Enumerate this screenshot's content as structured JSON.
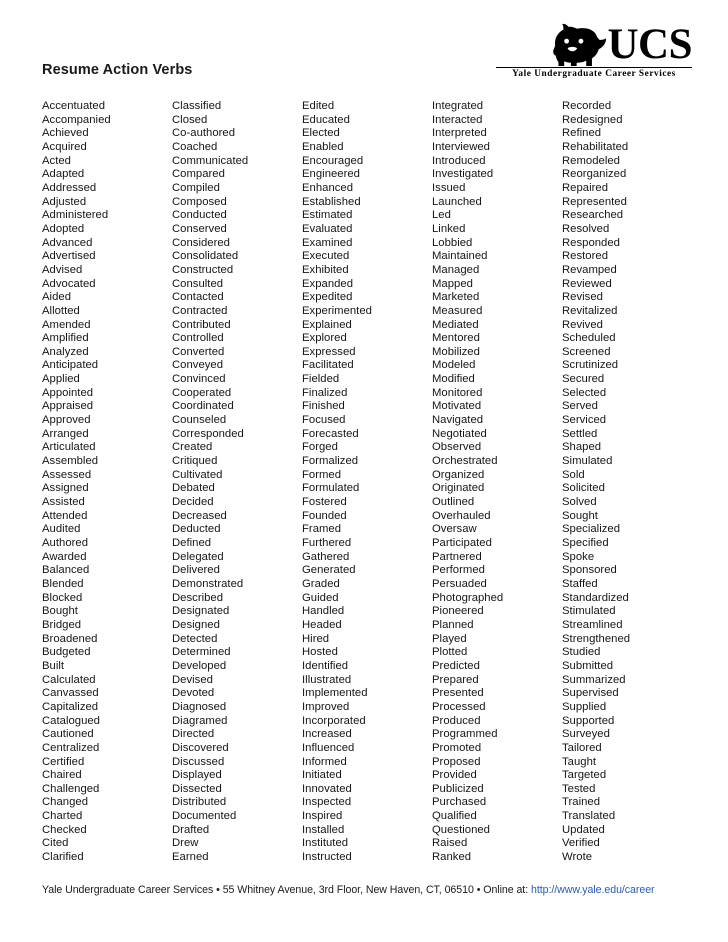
{
  "document": {
    "title": "Resume Action Verbs"
  },
  "logo": {
    "mark": "bulldog-icon",
    "acronym": "UCS",
    "subtitle": "Yale Undergraduate Career Services"
  },
  "columns": [
    {
      "id": "column-1",
      "words": [
        "Accentuated",
        "Accompanied",
        "Achieved",
        "Acquired",
        "Acted",
        "Adapted",
        "Addressed",
        "Adjusted",
        "Administered",
        "Adopted",
        "Advanced",
        "Advertised",
        "Advised",
        "Advocated",
        "Aided",
        "Allotted",
        "Amended",
        "Amplified",
        "Analyzed",
        "Anticipated",
        "Applied",
        "Appointed",
        "Appraised",
        "Approved",
        "Arranged",
        "Articulated",
        "Assembled",
        "Assessed",
        "Assigned",
        "Assisted",
        "Attended",
        "Audited",
        "Authored",
        "Awarded",
        "Balanced",
        "Blended",
        "Blocked",
        "Bought",
        "Bridged",
        "Broadened",
        "Budgeted",
        "Built",
        "Calculated",
        "Canvassed",
        "Capitalized",
        "Catalogued",
        "Cautioned",
        "Centralized",
        "Certified",
        "Chaired",
        "Challenged",
        "Changed",
        "Charted",
        "Checked",
        "Cited",
        "Clarified"
      ]
    },
    {
      "id": "column-2",
      "words": [
        "Classified",
        "Closed",
        "Co-authored",
        "Coached",
        "Communicated",
        "Compared",
        "Compiled",
        "Composed",
        "Conducted",
        "Conserved",
        "Considered",
        "Consolidated",
        "Constructed",
        "Consulted",
        "Contacted",
        "Contracted",
        "Contributed",
        "Controlled",
        "Converted",
        "Conveyed",
        "Convinced",
        "Cooperated",
        "Coordinated",
        "Counseled",
        "Corresponded",
        "Created",
        "Critiqued",
        "Cultivated",
        "Debated",
        "Decided",
        "Decreased",
        "Deducted",
        "Defined",
        "Delegated",
        "Delivered",
        "Demonstrated",
        "Described",
        "Designated",
        "Designed",
        "Detected",
        "Determined",
        "Developed",
        "Devised",
        "Devoted",
        "Diagnosed",
        "Diagramed",
        "Directed",
        "Discovered",
        "Discussed",
        "Displayed",
        "Dissected",
        "Distributed",
        "Documented",
        "Drafted",
        "Drew",
        "Earned"
      ]
    },
    {
      "id": "column-3",
      "words": [
        "Edited",
        "Educated",
        "Elected",
        "Enabled",
        "Encouraged",
        "Engineered",
        "Enhanced",
        "Established",
        "Estimated",
        "Evaluated",
        "Examined",
        "Executed",
        "Exhibited",
        "Expanded",
        "Expedited",
        "Experimented",
        "Explained",
        "Explored",
        "Expressed",
        "Facilitated",
        "Fielded",
        "Finalized",
        "Finished",
        "Focused",
        "Forecasted",
        "Forged",
        "Formalized",
        "Formed",
        "Formulated",
        "Fostered",
        "Founded",
        "Framed",
        "Furthered",
        "Gathered",
        "Generated",
        "Graded",
        "Guided",
        "Handled",
        "Headed",
        "Hired",
        "Hosted",
        "Identified",
        "Illustrated",
        "Implemented",
        "Improved",
        "Incorporated",
        "Increased",
        "Influenced",
        "Informed",
        "Initiated",
        "Innovated",
        "Inspected",
        "Inspired",
        "Installed",
        "Instituted",
        "Instructed"
      ]
    },
    {
      "id": "column-4",
      "words": [
        "Integrated",
        "Interacted",
        "Interpreted",
        "Interviewed",
        "Introduced",
        "Investigated",
        "Issued",
        "Launched",
        "Led",
        "Linked",
        "Lobbied",
        "Maintained",
        "Managed",
        "Mapped",
        "Marketed",
        "Measured",
        "Mediated",
        "Mentored",
        "Mobilized",
        "Modeled",
        "Modified",
        "Monitored",
        "Motivated",
        "Navigated",
        "Negotiated",
        "Observed",
        "Orchestrated",
        "Organized",
        "Originated",
        "Outlined",
        "Overhauled",
        "Oversaw",
        "Participated",
        "Partnered",
        "Performed",
        "Persuaded",
        "Photographed",
        "Pioneered",
        "Planned",
        "Played",
        "Plotted",
        "Predicted",
        "Prepared",
        "Presented",
        "Processed",
        "Produced",
        "Programmed",
        "Promoted",
        "Proposed",
        "Provided",
        "Publicized",
        "Purchased",
        "Qualified",
        "Questioned",
        "Raised",
        "Ranked"
      ]
    },
    {
      "id": "column-5",
      "words": [
        "Recorded",
        "Redesigned",
        "Refined",
        "Rehabilitated",
        "Remodeled",
        "Reorganized",
        "Repaired",
        "Represented",
        "Researched",
        "Resolved",
        "Responded",
        "Restored",
        "Revamped",
        "Reviewed",
        "Revised",
        "Revitalized",
        "Revived",
        "Scheduled",
        "Screened",
        "Scrutinized",
        "Secured",
        "Selected",
        "Served",
        "Serviced",
        "Settled",
        "Shaped",
        "Simulated",
        "Sold",
        "Solicited",
        "Solved",
        "Sought",
        "Specialized",
        "Specified",
        "Spoke",
        "Sponsored",
        "Staffed",
        "Standardized",
        "Stimulated",
        "Streamlined",
        "Strengthened",
        "Studied",
        "Submitted",
        "Summarized",
        "Supervised",
        "Supplied",
        "Supported",
        "Surveyed",
        "Tailored",
        "Taught",
        "Targeted",
        "Tested",
        "Trained",
        "Translated",
        "Updated",
        "Verified",
        "Wrote"
      ]
    }
  ],
  "footer": {
    "org": "Yale Undergraduate Career Services",
    "separator_1": " • ",
    "address": "55 Whitney Avenue, 3rd Floor, New Haven, CT, 06510",
    "separator_2": " • ",
    "online_label": "Online at: ",
    "url": "http://www.yale.edu/career",
    "link_color": "#2b5bb5"
  }
}
